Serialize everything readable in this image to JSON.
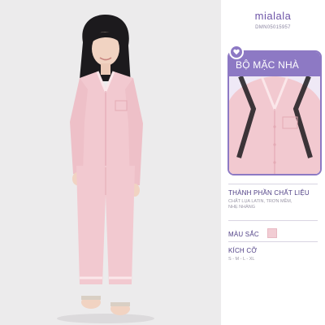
{
  "brand": {
    "name": "mialala",
    "sku": "DMN05015957"
  },
  "category": {
    "label": "BỘ MẶC NHÀ",
    "icon": "heart-icon"
  },
  "details": {
    "material": {
      "title": "THÀNH PHẦN CHẤT LIỆU",
      "body_line1": "CHẤT LỤA LATIN, TRƠN MỀM,",
      "body_line2": "NHẸ NHÀNG"
    },
    "color": {
      "title": "MÀU SẮC",
      "swatch": "#f2cdd4"
    },
    "size": {
      "title": "KÍCH CỠ",
      "values": "S - M - L - XL"
    }
  },
  "colors": {
    "accent": "#8d79c4",
    "brand_text": "#6f56a8",
    "garment": "#f2c9d0"
  }
}
